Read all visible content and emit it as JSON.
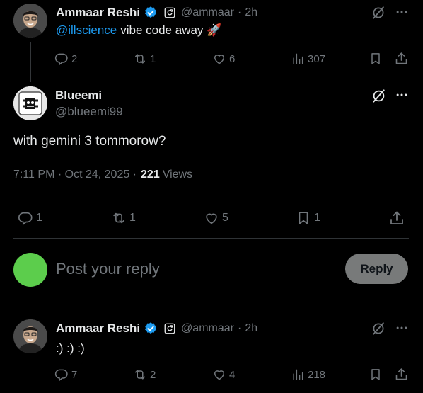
{
  "thread_top": {
    "author_name": "Ammaar Reshi",
    "handle": "@ammaar",
    "time": "2h",
    "mention": "@illscience",
    "text_rest": "vibe code away",
    "rocket": "🚀",
    "stats": {
      "replies": "2",
      "reposts": "1",
      "likes": "6",
      "views": "307"
    }
  },
  "main_post": {
    "author_name": "Blueemi",
    "handle": "@blueemi99",
    "text": "with gemini 3 tommorow?",
    "timestamp": "7:11 PM · Oct 24, 2025 ·",
    "views_count": "221",
    "views_label": "Views",
    "stats": {
      "replies": "1",
      "reposts": "1",
      "likes": "5",
      "bookmarks": "1"
    }
  },
  "composer": {
    "placeholder": "Post your reply",
    "button_label": "Reply"
  },
  "reply_post": {
    "author_name": "Ammaar Reshi",
    "handle": "@ammaar",
    "time": "2h",
    "text": ":) :) :)",
    "stats": {
      "replies": "7",
      "reposts": "2",
      "likes": "4",
      "views": "218"
    }
  },
  "colors": {
    "background": "#000000",
    "text": "#e7e9ea",
    "muted": "#71767b",
    "link": "#1d9bf0",
    "verified": "#1d9bf0",
    "composer_avatar": "#5ccd4c",
    "reply_button": "#787a7a"
  },
  "icons": [
    "verified-badge-icon",
    "subscription-badge-icon",
    "grok-icon",
    "more-icon",
    "reply-icon",
    "repost-icon",
    "like-icon",
    "views-icon",
    "bookmark-icon",
    "share-icon"
  ]
}
